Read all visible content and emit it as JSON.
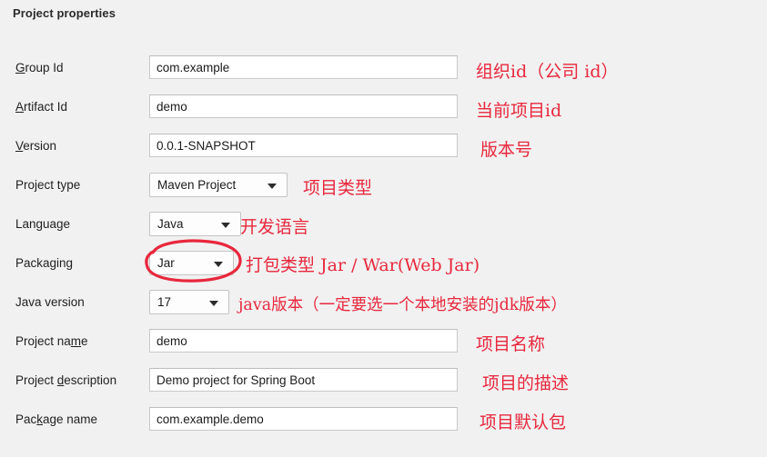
{
  "panel": {
    "title": "Project properties",
    "background_color": "#f1f1f1",
    "annotation_color": "#e8273c"
  },
  "fields": [
    {
      "name": "group-id",
      "label_pre": "",
      "label_mnemonic": "G",
      "label_post": "roup Id",
      "control": "text",
      "value": "com.example",
      "annotation": "组织id（公司 id）"
    },
    {
      "name": "artifact-id",
      "label_pre": "",
      "label_mnemonic": "A",
      "label_post": "rtifact Id",
      "control": "text",
      "value": "demo",
      "annotation": "当前项目id"
    },
    {
      "name": "version",
      "label_pre": "",
      "label_mnemonic": "V",
      "label_post": "ersion",
      "control": "text",
      "value": "0.0.1-SNAPSHOT",
      "annotation": "版本号"
    },
    {
      "name": "project-type",
      "label_pre": "Project type",
      "label_mnemonic": "",
      "label_post": "",
      "control": "combo",
      "value": "Maven Project",
      "annotation": "项目类型"
    },
    {
      "name": "language",
      "label_pre": "Language",
      "label_mnemonic": "",
      "label_post": "",
      "control": "combo",
      "value": "Java",
      "annotation": "开发语言"
    },
    {
      "name": "packaging",
      "label_pre": "Packaging",
      "label_mnemonic": "",
      "label_post": "",
      "control": "combo",
      "value": "Jar",
      "annotation": "打包类型   Jar / War(Web Jar)",
      "highlighted": true
    },
    {
      "name": "java-version",
      "label_pre": "Java version",
      "label_mnemonic": "",
      "label_post": "",
      "control": "combo",
      "value": "17",
      "annotation": "java版本（一定要选一个本地安装的jdk版本）"
    },
    {
      "name": "project-name",
      "label_pre": "Project na",
      "label_mnemonic": "m",
      "label_post": "e",
      "control": "text",
      "value": "demo",
      "annotation": "项目名称"
    },
    {
      "name": "project-description",
      "label_pre": "Project ",
      "label_mnemonic": "d",
      "label_post": "escription",
      "control": "text",
      "value": "Demo project for Spring Boot",
      "annotation": "项目的描述"
    },
    {
      "name": "package-name",
      "label_pre": "Pac",
      "label_mnemonic": "k",
      "label_post": "age name",
      "control": "text",
      "value": "com.example.demo",
      "annotation": "项目默认包"
    }
  ],
  "highlight": {
    "shape": "hand-drawn-ellipse",
    "target": "packaging-combo",
    "color": "#e8273c"
  }
}
